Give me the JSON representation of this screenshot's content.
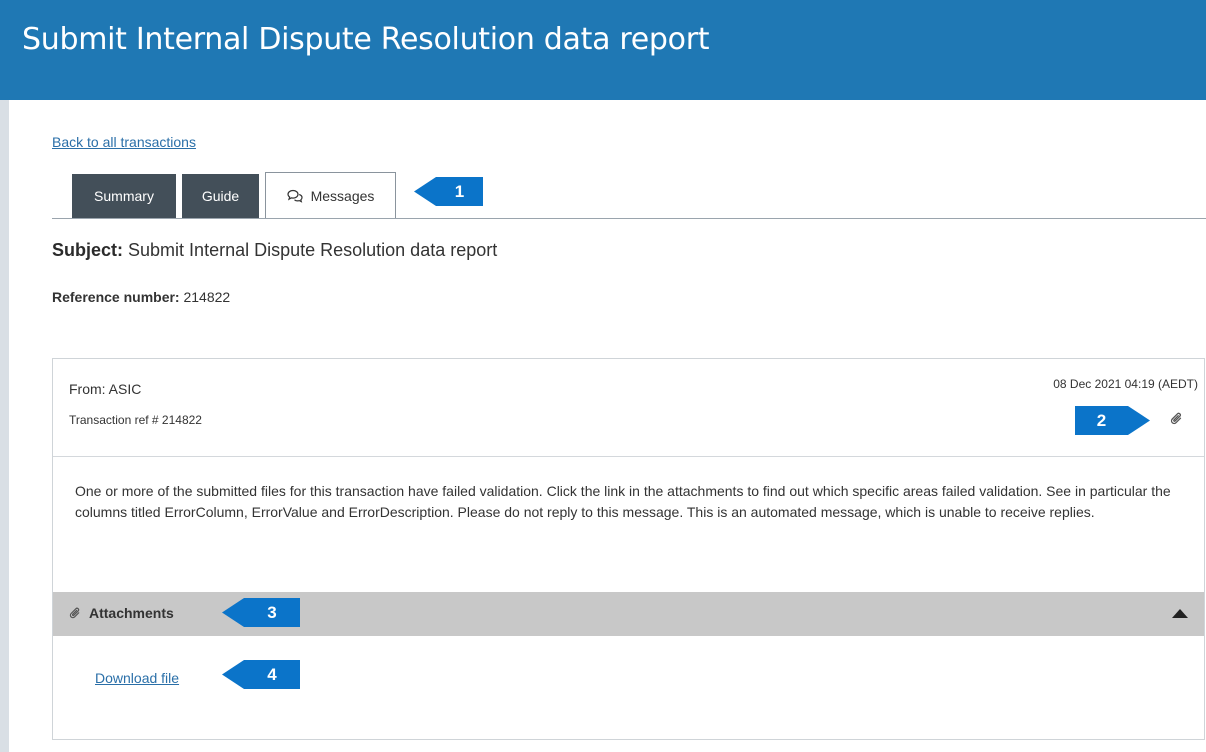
{
  "header": {
    "title": "Submit Internal Dispute Resolution data report"
  },
  "nav": {
    "back_link": "Back to all transactions"
  },
  "tabs": [
    {
      "label": "Summary",
      "state": "inactive"
    },
    {
      "label": "Guide",
      "state": "inactive"
    },
    {
      "label": "Messages",
      "state": "active",
      "icon": "chat-bubbles-icon"
    }
  ],
  "subject": {
    "label": "Subject:",
    "value": "Submit Internal Dispute Resolution data report"
  },
  "reference": {
    "label": "Reference number:",
    "value": "214822"
  },
  "message": {
    "from": "From: ASIC",
    "transaction_ref": "Transaction ref # 214822",
    "datetime": "08 Dec 2021 04:19 (AEDT)",
    "attachment_icon": "paperclip-icon",
    "body": "One or more of the submitted files for this transaction have failed validation. Click the link in the attachments to find out which specific areas failed validation. See in particular the columns titled ErrorColumn, ErrorValue and ErrorDescription. Please do not reply to this message. This is an automated message, which is unable to receive replies."
  },
  "attachments": {
    "label": "Attachments",
    "icon": "paperclip-icon",
    "toggle_icon": "caret-up-icon",
    "download_label": "Download file"
  },
  "callouts": [
    "1",
    "2",
    "3",
    "4"
  ],
  "colors": {
    "header": "#1f78b4",
    "tab_dark": "#434f59",
    "callout": "#0b74c9",
    "link": "#2a6fa8",
    "attachments_bar": "#c8c8c8"
  }
}
